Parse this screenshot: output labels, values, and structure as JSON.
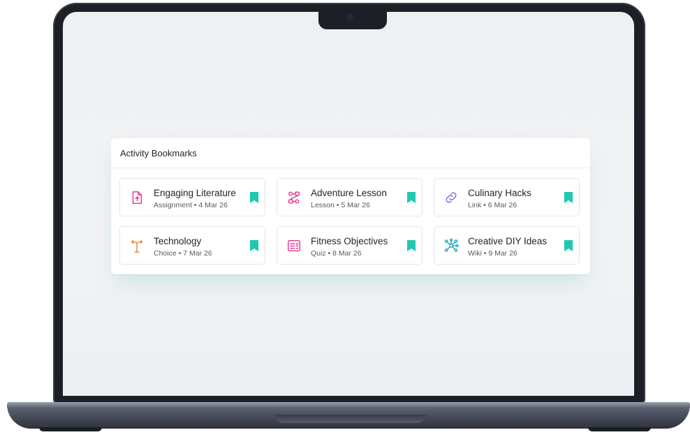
{
  "panel": {
    "title": "Activity Bookmarks",
    "accent": "#1fc8b0",
    "items": [
      {
        "title": "Engaging Literature",
        "meta": "Assignment • 4 Mar 26",
        "icon": "file-upload-icon",
        "color": "#e8338e"
      },
      {
        "title": "Adventure Lesson",
        "meta": "Lesson • 5 Mar 26",
        "icon": "lesson-flow-icon",
        "color": "#e8338e"
      },
      {
        "title": "Culinary Hacks",
        "meta": "Link • 6 Mar 26",
        "icon": "link-icon",
        "color": "#7b5cf0"
      },
      {
        "title": "Technology",
        "meta": "Choice • 7 Mar 26",
        "icon": "choice-signpost-icon",
        "color": "#f07a2a"
      },
      {
        "title": "Fitness Objectives",
        "meta": "Quiz • 8 Mar 26",
        "icon": "quiz-list-icon",
        "color": "#e8338e"
      },
      {
        "title": "Creative DIY Ideas",
        "meta": "Wiki • 9 Mar 26",
        "icon": "wiki-network-icon",
        "color": "#1aa5b8"
      }
    ]
  }
}
